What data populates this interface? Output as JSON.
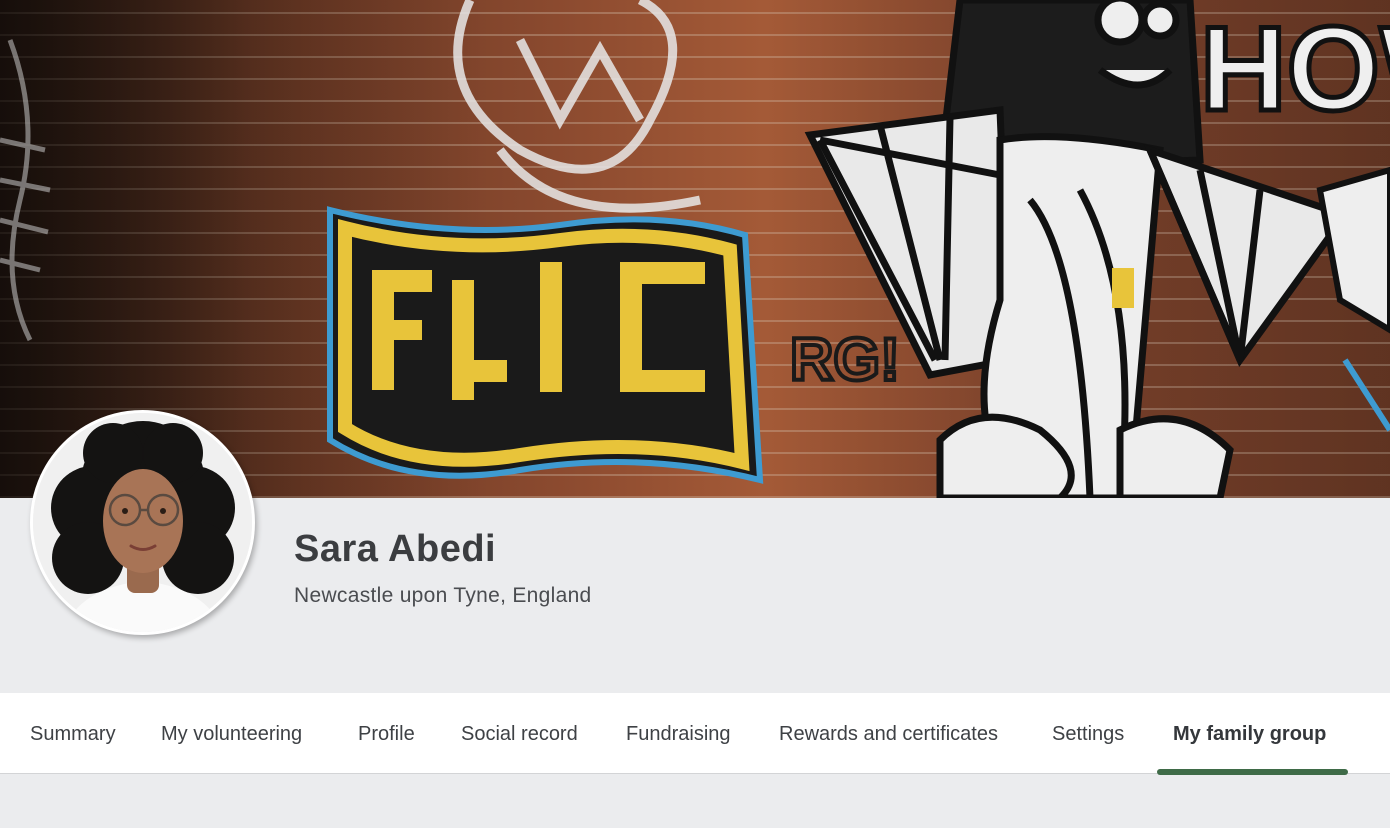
{
  "profile": {
    "name": "Sara Abedi",
    "location": "Newcastle upon Tyne, England"
  },
  "cover": {
    "graffiti_text": "HOW"
  },
  "tabs": [
    {
      "label": "Summary",
      "active": false
    },
    {
      "label": "My volunteering",
      "active": false
    },
    {
      "label": "Profile",
      "active": false
    },
    {
      "label": "Social record",
      "active": false
    },
    {
      "label": "Fundraising",
      "active": false
    },
    {
      "label": "Rewards and certificates",
      "active": false
    },
    {
      "label": "Settings",
      "active": false
    },
    {
      "label": "My family group",
      "active": true
    }
  ],
  "colors": {
    "accent": "#3f6b48",
    "page_background": "#ebecee",
    "tab_bar_background": "#ffffff",
    "name_text": "#3b3d40"
  }
}
